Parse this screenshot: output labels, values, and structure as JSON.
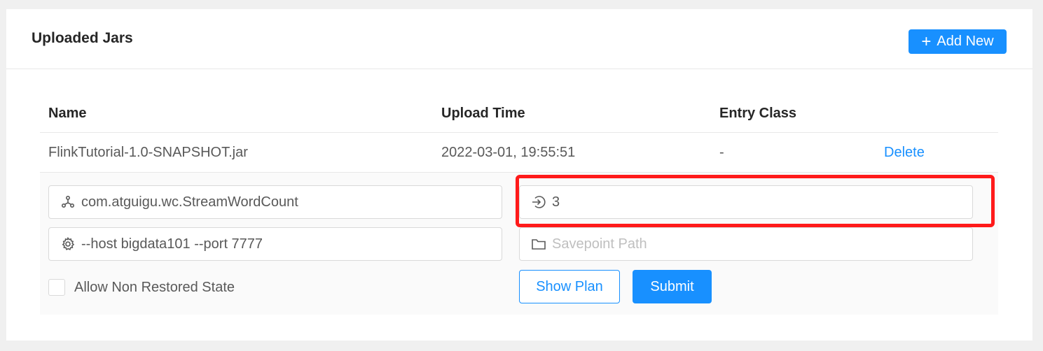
{
  "card": {
    "title": "Uploaded Jars",
    "add_button_label": "Add New"
  },
  "table": {
    "headers": [
      "Name",
      "Upload Time",
      "Entry Class"
    ],
    "rows": [
      {
        "name": "FlinkTutorial-1.0-SNAPSHOT.jar",
        "upload_time": "2022-03-01, 19:55:51",
        "entry_class": "-",
        "action": "Delete"
      }
    ]
  },
  "submit_form": {
    "entry_class_value": "com.atguigu.wc.StreamWordCount",
    "parallelism_value": "3",
    "program_args_value": "--host bigdata101 --port 7777",
    "savepoint_placeholder": "Savepoint Path",
    "allow_non_restored_label": "Allow Non Restored State",
    "allow_non_restored_checked": false,
    "show_plan_label": "Show Plan",
    "submit_label": "Submit"
  },
  "colors": {
    "primary": "#1890ff",
    "highlight": "#ff1a1a"
  }
}
